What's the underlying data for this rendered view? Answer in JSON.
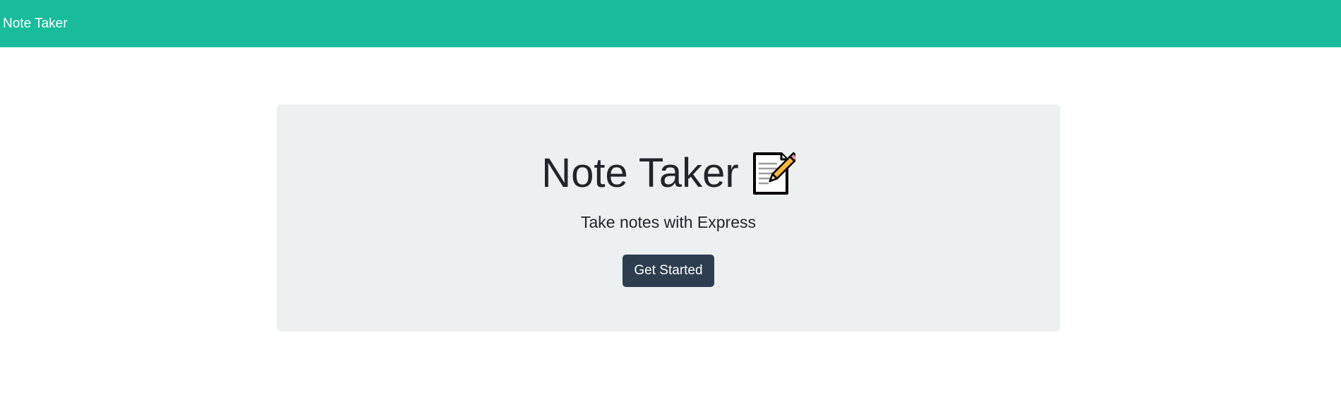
{
  "navbar": {
    "brand_label": "Note Taker",
    "background_color": "#18bc9c"
  },
  "hero": {
    "title": "Note Taker",
    "title_icon": "memo-icon",
    "tagline": "Take notes with Express",
    "button_label": "Get Started",
    "background_color": "#ecf0f1",
    "button_color": "#2c3e50"
  }
}
